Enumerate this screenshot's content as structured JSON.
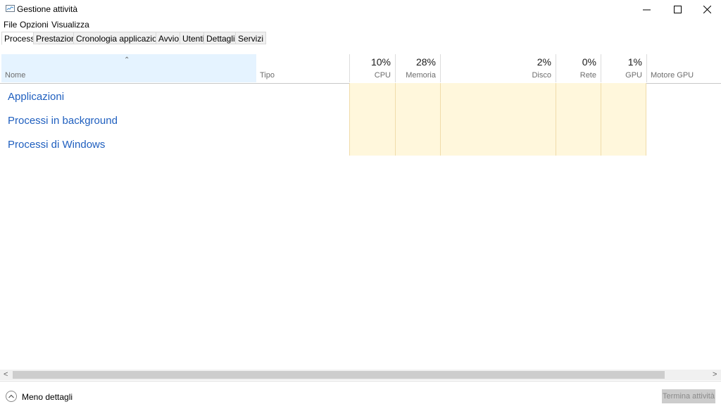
{
  "window": {
    "title": "Gestione attività"
  },
  "menu": [
    "File",
    "Opzioni",
    "Visualizza"
  ],
  "tabs": [
    "Processi",
    "Prestazioni",
    "Cronologia applicazioni",
    "Avvio",
    "Utenti",
    "Dettagli",
    "Servizi"
  ],
  "active_tab": "Processi",
  "columns": {
    "name": {
      "label": "Nome"
    },
    "type": {
      "label": "Tipo"
    },
    "cpu": {
      "label": "CPU",
      "pct": "10%"
    },
    "memory": {
      "label": "Memoria",
      "pct": "28%"
    },
    "disk": {
      "label": "Disco",
      "pct": "2%"
    },
    "network": {
      "label": "Rete",
      "pct": "0%"
    },
    "gpu": {
      "label": "GPU",
      "pct": "1%"
    },
    "gpu_engine": {
      "label": "Motore GPU"
    }
  },
  "groups": [
    "Applicazioni",
    "Processi in background",
    "Processi di Windows"
  ],
  "footer": {
    "less_details": "Meno dettagli",
    "end_task": "Termina attività"
  },
  "colors": {
    "accent_link": "#1f5fbf",
    "heat": "#fff7dc",
    "sorted_header": "#e5f3ff"
  }
}
